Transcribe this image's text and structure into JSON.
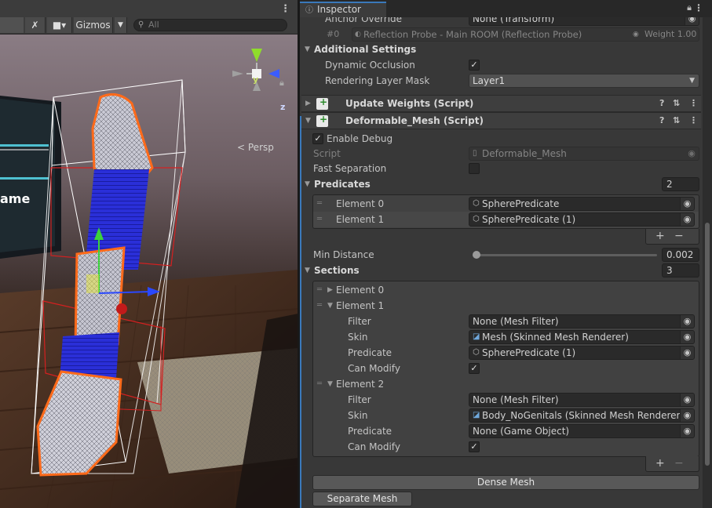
{
  "scene": {
    "gizmos_label": "Gizmos",
    "search_placeholder": "All",
    "persp_label": "Persp",
    "axis_y": "y",
    "axis_z": "z",
    "wall_text": "ame"
  },
  "inspector": {
    "tab_label": "Inspector",
    "anchor_override": {
      "label": "Anchor Override",
      "value": "None (Transform)"
    },
    "reflection_probe": {
      "index": "#0",
      "value": "Reflection Probe - Main ROOM (Reflection Probe)",
      "weight": "Weight 1.00"
    },
    "additional_settings": {
      "title": "Additional Settings",
      "dynamic_occlusion_label": "Dynamic Occlusion",
      "dynamic_occlusion_checked": true,
      "rendering_layer_mask_label": "Rendering Layer Mask",
      "rendering_layer_mask_value": "Layer1"
    },
    "components": [
      {
        "title": "Update Weights (Script)",
        "expanded": false
      },
      {
        "title": "Deformable_Mesh (Script)",
        "expanded": true
      }
    ],
    "deformable": {
      "enable_debug_label": "Enable Debug",
      "enable_debug_checked": true,
      "script_label": "Script",
      "script_value": "Deformable_Mesh",
      "fast_separation_label": "Fast Separation",
      "fast_separation_checked": false,
      "predicates": {
        "title": "Predicates",
        "size": "2",
        "elements": [
          {
            "label": "Element 0",
            "value": "SpherePredicate"
          },
          {
            "label": "Element 1",
            "value": "SpherePredicate (1)"
          }
        ]
      },
      "min_distance": {
        "label": "Min Distance",
        "value": "0.002",
        "fraction": 0.002
      },
      "sections": {
        "title": "Sections",
        "size": "3",
        "element0_label": "Element 0",
        "element1": {
          "label": "Element 1",
          "filter_label": "Filter",
          "filter_value": "None (Mesh Filter)",
          "skin_label": "Skin",
          "skin_value": "Mesh (Skinned Mesh Renderer)",
          "predicate_label": "Predicate",
          "predicate_value": "SpherePredicate (1)",
          "can_modify_label": "Can Modify",
          "can_modify_checked": true
        },
        "element2": {
          "label": "Element 2",
          "filter_label": "Filter",
          "filter_value": "None (Mesh Filter)",
          "skin_label": "Skin",
          "skin_value": "Body_NoGenitals (Skinned Mesh Renderer)",
          "predicate_label": "Predicate",
          "predicate_value": "None (Game Object)",
          "can_modify_label": "Can Modify",
          "can_modify_checked": true
        }
      },
      "dense_mesh_label": "Dense Mesh",
      "separate_mesh_label": "Separate Mesh"
    }
  },
  "colors": {
    "accent": "#3a79bb",
    "bone_outline": "#ff6a1a",
    "bounds_red": "#d42020"
  }
}
